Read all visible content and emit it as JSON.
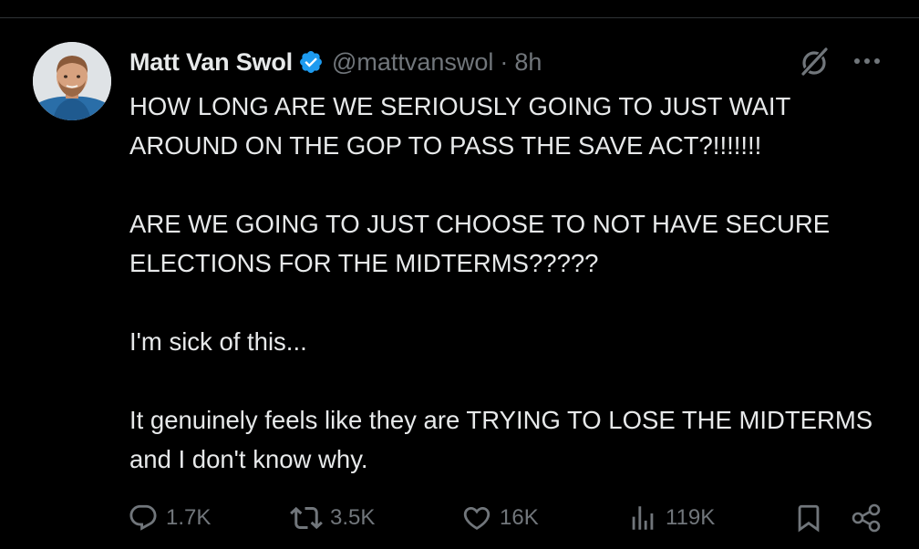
{
  "tweet": {
    "author": {
      "display_name": "Matt Van Swol",
      "handle": "@mattvanswol",
      "separator": "·",
      "time": "8h",
      "verified": true,
      "avatar_icon": "profile-photo"
    },
    "paragraphs": [
      "HOW LONG ARE WE SERIOUSLY GOING TO JUST WAIT AROUND ON THE GOP TO PASS THE SAVE ACT?!!!!!!!",
      "ARE WE GOING TO JUST CHOOSE TO NOT HAVE SECURE ELECTIONS FOR THE MIDTERMS?????",
      "I'm sick of this...",
      "It genuinely feels like they are TRYING TO LOSE THE MIDTERMS and I don't know why."
    ],
    "metrics": {
      "replies": "1.7K",
      "reposts": "3.5K",
      "likes": "16K",
      "views": "119K"
    }
  },
  "icons": {
    "header": [
      "verified-badge-icon",
      "grok-icon",
      "more-icon"
    ],
    "actions": [
      "reply-icon",
      "repost-icon",
      "like-icon",
      "views-icon",
      "bookmark-icon",
      "share-icon"
    ]
  },
  "colors": {
    "background": "#000000",
    "text": "#e7e9ea",
    "muted": "#71767b",
    "verified": "#1d9bf0",
    "divider": "#2f3336"
  }
}
